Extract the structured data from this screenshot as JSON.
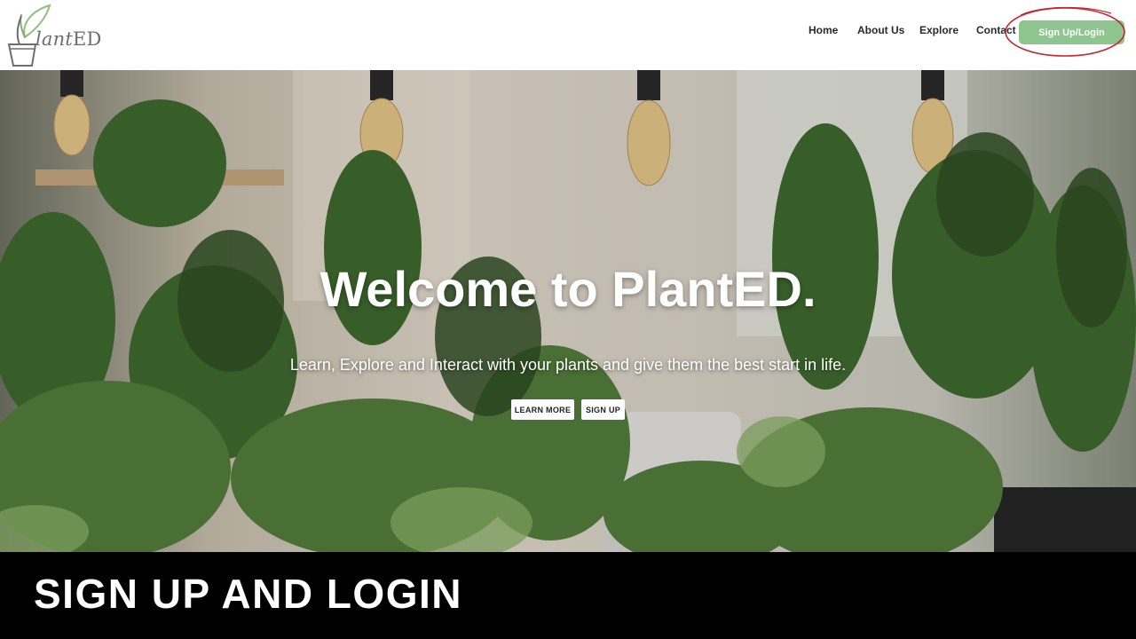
{
  "header": {
    "logo": {
      "script": "lant",
      "caps": "ED"
    },
    "nav": [
      {
        "label": "Home"
      },
      {
        "label": "About Us"
      },
      {
        "label": "Explore"
      },
      {
        "label": "Contact"
      }
    ],
    "cta_label": "Sign Up/Login",
    "cta_color": "#8fc58f",
    "annotation_color": "#c4262e"
  },
  "hero": {
    "title": "Welcome to PlantED.",
    "subtitle": "Learn, Explore and Interact with your plants and give them the best start in life.",
    "learn_more_label": "LEARN MORE",
    "sign_up_label": "SIGN UP"
  },
  "banner": {
    "text": "SIGN UP AND LOGIN"
  }
}
